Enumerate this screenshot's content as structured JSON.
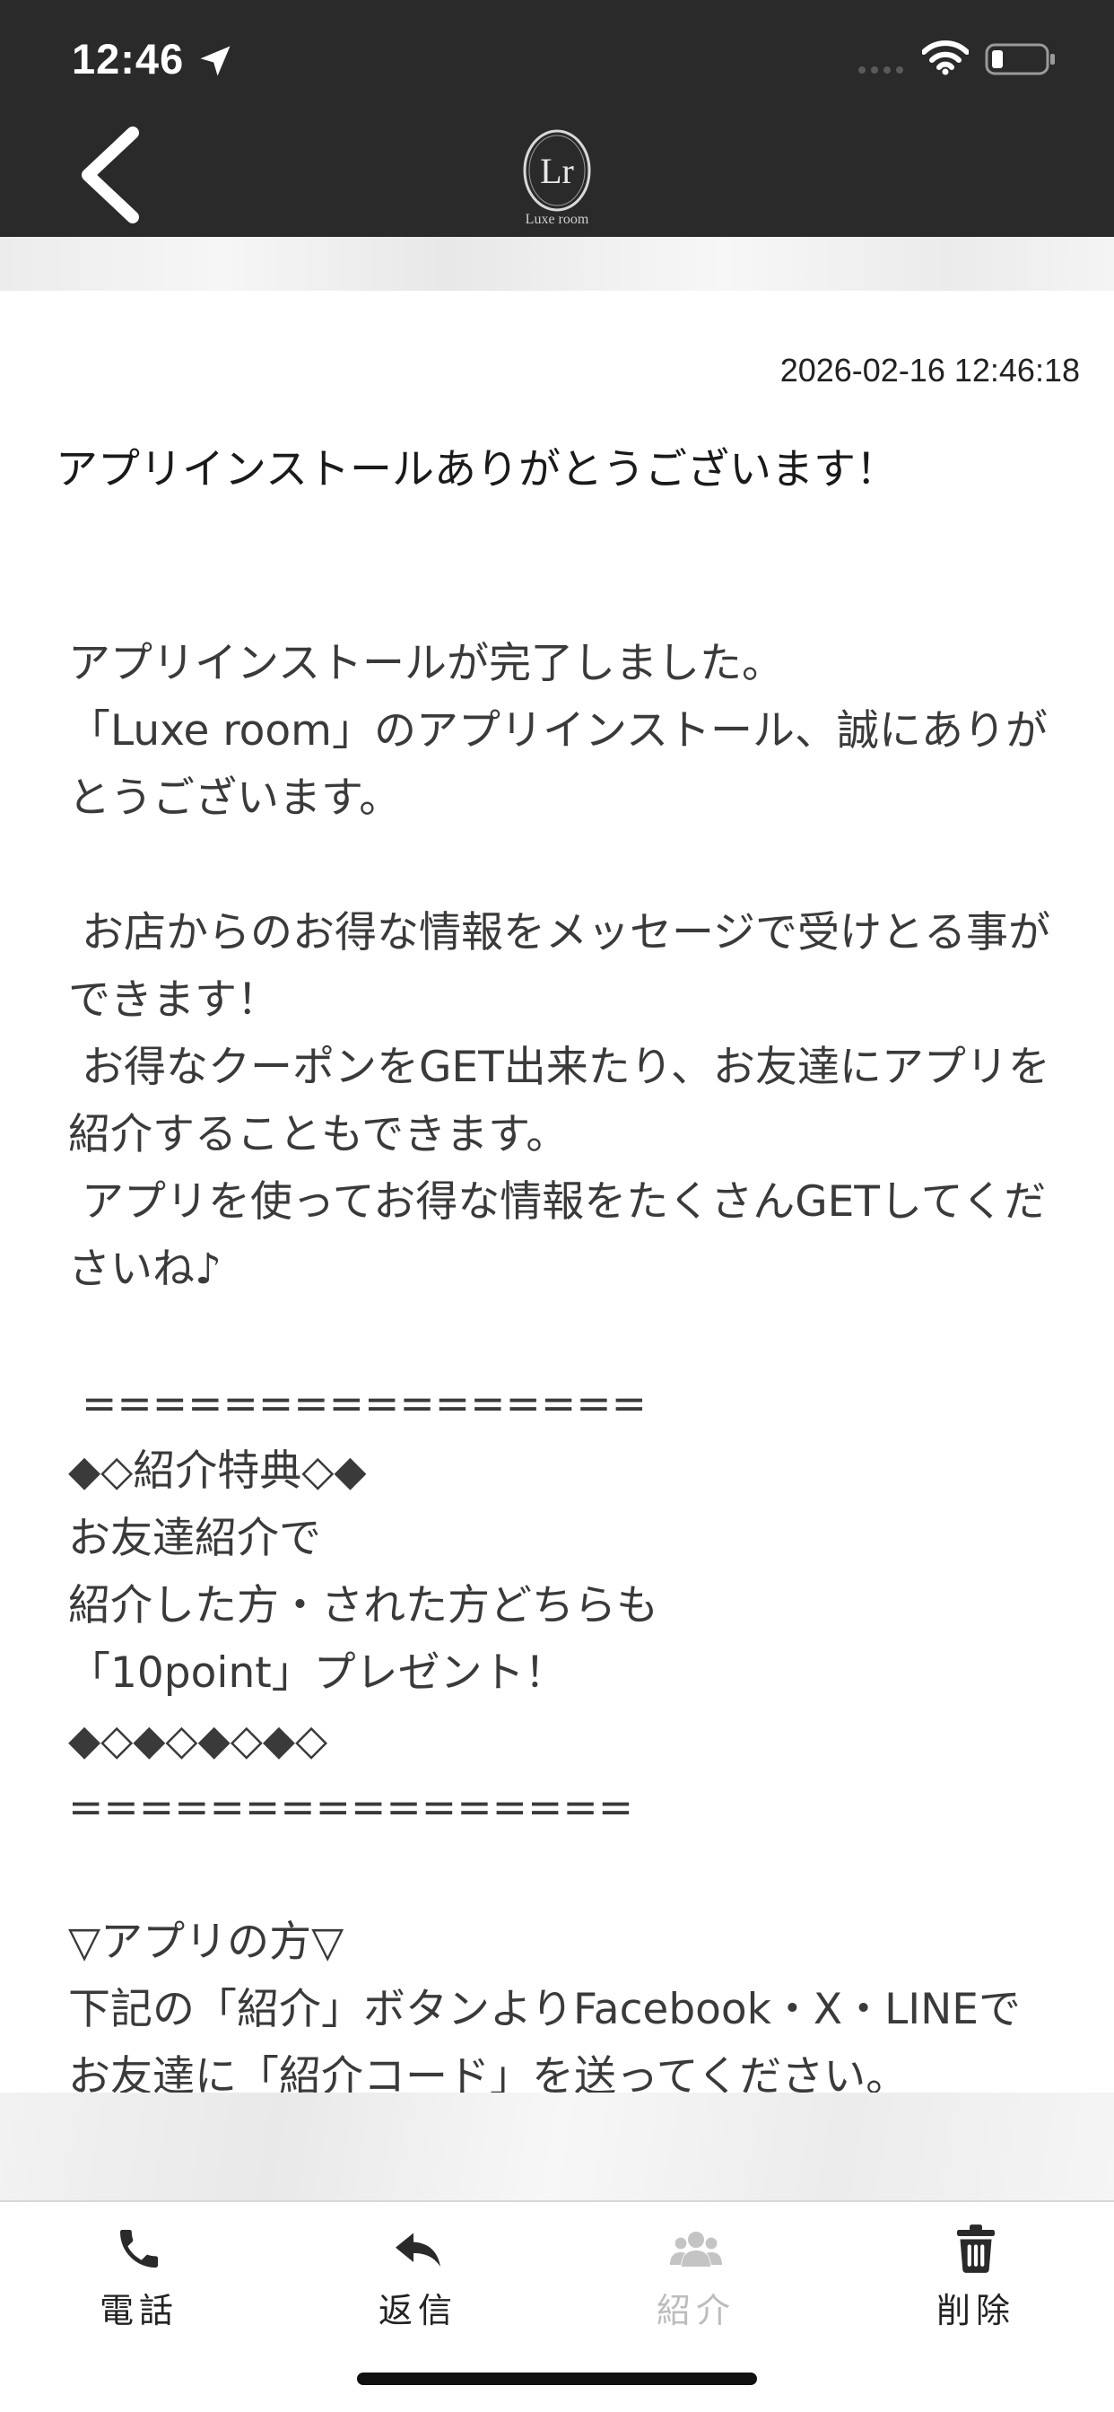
{
  "status_bar": {
    "time": "12:46"
  },
  "header": {
    "logo_text": "Luxe room"
  },
  "message": {
    "timestamp": "2026-02-16 12:46:18",
    "title": "アプリインストールありがとうございます！",
    "body": "アプリインストールが完了しました。\n「Luxe room」のアプリインストール、誠にありがとうございます。\n\n お店からのお得な情報をメッセージで受けとる事ができます！\n お得なクーポンをGET出来たり、お友達にアプリを紹介することもできます。\n アプリを使ってお得な情報をたくさんGETしてくださいね♪\n\n ================\n◆◇紹介特典◇◆\nお友達紹介で\n紹介した方・された方どちらも\n「10point」プレゼント！\n◆◇◆◇◆◇◆◇\n================\n\n▽アプリの方▽\n下記の「紹介」ボタンよりFacebook・X・LINEでお友達に「紹介コード」を送ってください。"
  },
  "bottom_nav": {
    "phone_label": "電話",
    "reply_label": "返信",
    "invite_label": "紹介",
    "delete_label": "削除"
  },
  "colors": {
    "header_bg": "#2a2a2a",
    "disabled": "#bdbdbd",
    "text": "#222222"
  }
}
